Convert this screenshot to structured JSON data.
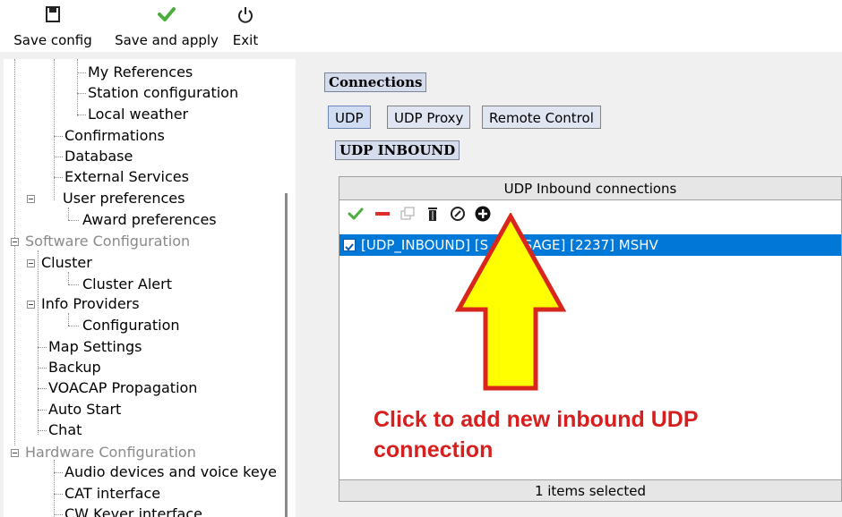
{
  "toolbar": {
    "save_config": "Save config",
    "save_apply": "Save and apply",
    "exit": "Exit"
  },
  "tree": {
    "my_references": "My References",
    "station_configuration": "Station configuration",
    "local_weather": "Local weather",
    "confirmations": "Confirmations",
    "database": "Database",
    "external_services": "External Services",
    "user_preferences": "User preferences",
    "award_preferences": "Award preferences",
    "software_configuration": "Software Configuration",
    "cluster": "Cluster",
    "cluster_alert": "Cluster Alert",
    "info_providers": "Info Providers",
    "configuration": "Configuration",
    "map_settings": "Map Settings",
    "backup": "Backup",
    "voacap": "VOACAP Propagation",
    "auto_start": "Auto Start",
    "chat": "Chat",
    "hardware_configuration": "Hardware Configuration",
    "audio_devices": "Audio devices and voice keye",
    "cat_interface": "CAT interface",
    "cw_keyer": "CW Keyer interface"
  },
  "connections": {
    "title": "Connections",
    "tabs": [
      "UDP",
      "UDP Proxy",
      "Remote Control"
    ],
    "active_tab": "UDP"
  },
  "udp_inbound": {
    "section_label": "UDP INBOUND",
    "table_header": "UDP Inbound connections",
    "row_text": "[UDP_INBOUND] [S_MESSAGE] [2237] MSHV",
    "status": "1 items selected"
  },
  "annotation": {
    "line1": "Click to add new inbound UDP",
    "line2": "connection"
  },
  "colors": {
    "selection": "#0078d7",
    "annotation_text": "#d71f1f",
    "arrow_fill": "#ffff00",
    "arrow_stroke": "#d9261c"
  }
}
